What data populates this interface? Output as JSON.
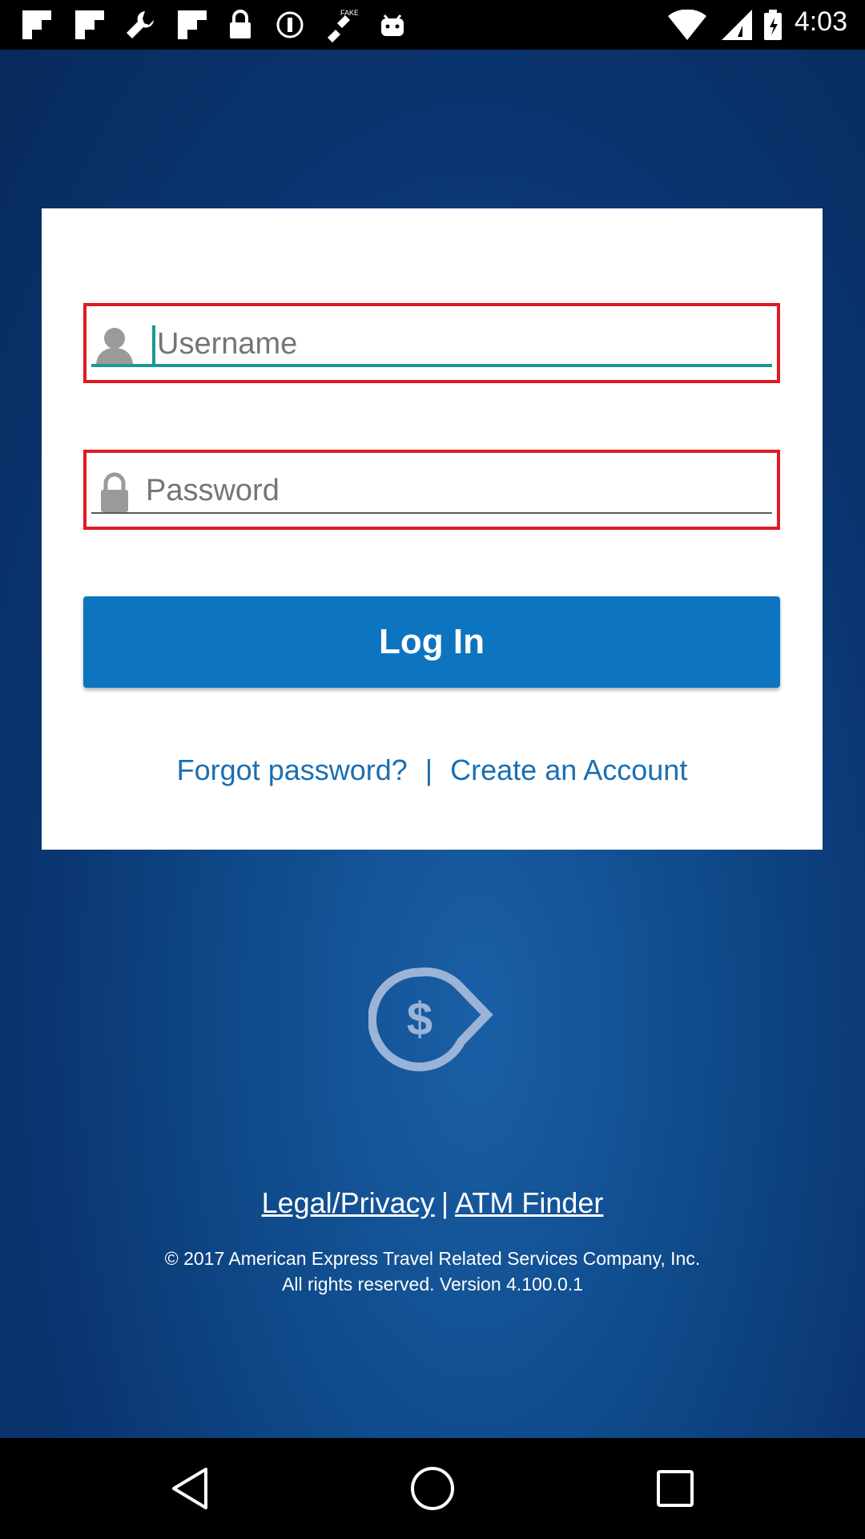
{
  "status_bar": {
    "time": "4:03",
    "icons": [
      "flipboard-icon",
      "flipboard-icon",
      "wrench-icon",
      "flipboard-icon",
      "lock-icon",
      "info-icon",
      "fake-gps-icon",
      "android-icon",
      "wifi-icon",
      "signal-icon",
      "battery-icon"
    ]
  },
  "login": {
    "username_placeholder": "Username",
    "password_placeholder": "Password",
    "login_label": "Log In",
    "forgot_password": "Forgot password?",
    "separator": "|",
    "create_account": "Create an Account"
  },
  "footer": {
    "legal_privacy": "Legal/Privacy",
    "separator": "|",
    "atm_finder": "ATM Finder",
    "copyright_line1": "© 2017 American Express Travel Related Services Company, Inc.",
    "copyright_line2": "All rights reserved. Version 4.100.0.1"
  },
  "colors": {
    "accent_blue": "#0d75c0",
    "error_red": "#e01b24",
    "focus_teal": "#1a9a91",
    "background_blue": "#0a3570"
  },
  "nav": {
    "icons": [
      "back-icon",
      "home-icon",
      "recents-icon"
    ]
  }
}
